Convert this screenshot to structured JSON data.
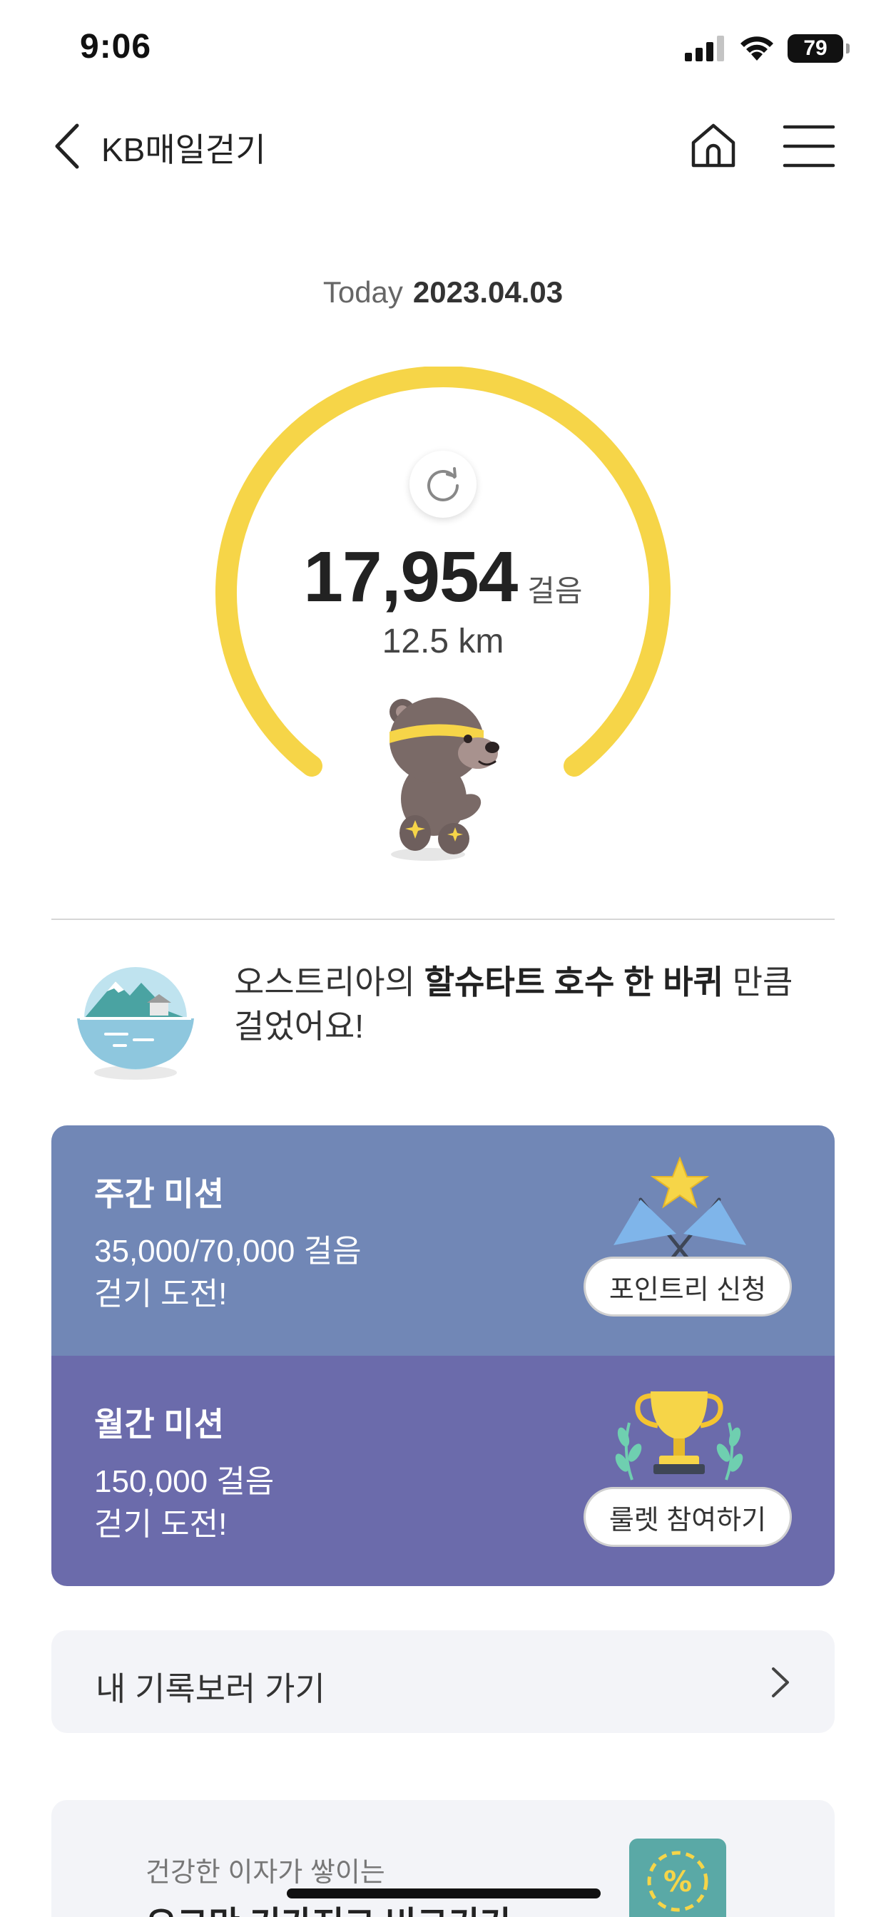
{
  "status_bar": {
    "time": "9:06",
    "battery": "79"
  },
  "nav": {
    "title": "KB매일걷기"
  },
  "today": {
    "label": "Today",
    "date": "2023.04.03"
  },
  "steps": {
    "count": "17,954",
    "unit": "걸음",
    "distance": "12.5 km"
  },
  "achievement": {
    "prefix": "오스트리아의 ",
    "highlight": "할슈타트 호수 한 바퀴",
    "suffix": " 만큼",
    "line2": "걸었어요!"
  },
  "missions": {
    "weekly": {
      "title": "주간 미션",
      "progress": "35,000/70,000 걸음",
      "subtitle": "걷기 도전!",
      "button": "포인트리 신청"
    },
    "monthly": {
      "title": "월간 미션",
      "progress": "150,000 걸음",
      "subtitle": "걷기 도전!",
      "button": "룰렛 참여하기"
    }
  },
  "record": {
    "label": "내 기록보러 가기"
  },
  "promo": {
    "subtitle": "건강한 이자가 쌓이는",
    "title": "오그만 기가저그 비크키기"
  },
  "colors": {
    "gauge_yellow": "#f6d548",
    "weekly_bg": "#7187b6",
    "monthly_bg": "#6b6bab",
    "card_bg": "#f3f4f8"
  }
}
